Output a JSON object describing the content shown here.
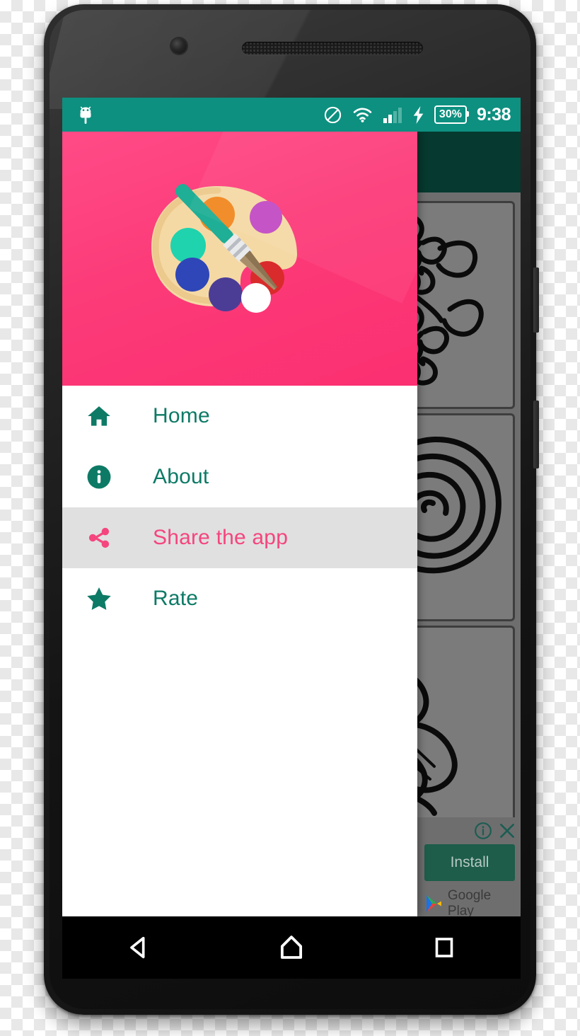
{
  "device": {
    "name": "android-smartphone",
    "front_camera": "front-camera",
    "earpiece": "earpiece-speaker",
    "bottom_speaker": "bottom-speaker",
    "buttons": [
      "power-button",
      "volume-button"
    ]
  },
  "status_bar": {
    "background": "#0d9080",
    "notification_icon": "android-robot-icon",
    "icons": [
      "do-not-disturb-icon",
      "wifi-icon",
      "cellular-signal-icon",
      "charging-bolt-icon"
    ],
    "battery_level": "30%",
    "clock": "9:38"
  },
  "drawer": {
    "background": "#ffffff",
    "header": {
      "background": "#fc3b79",
      "artwork": "paint-palette-with-brush",
      "palette_base_color": "#f7d9a0",
      "brush_handle_color": "#1fae96",
      "well_colors": [
        "#f2871f",
        "#c04bc0",
        "#1fd6b0",
        "#2f46b8",
        "#d92b2b",
        "#4b3d96",
        "#ffffff"
      ]
    },
    "accent_color": "#0d7a66",
    "selected_color": "#f5457e",
    "selected_background": "#e0e0e0",
    "items": [
      {
        "id": "home",
        "label": "Home",
        "icon": "home-icon",
        "selected": false
      },
      {
        "id": "about",
        "label": "About",
        "icon": "info-icon",
        "selected": false
      },
      {
        "id": "share",
        "label": "Share the app",
        "icon": "share-icon",
        "selected": true
      },
      {
        "id": "rate",
        "label": "Rate",
        "icon": "star-icon",
        "selected": false
      }
    ]
  },
  "background_app": {
    "app_bar_color": "#06392f",
    "scrim_color": "#6e6e6e",
    "cards": [
      {
        "id": "card-daisies",
        "artwork": "daisy-flowers-line-art"
      },
      {
        "id": "card-rose",
        "artwork": "rose-line-art"
      },
      {
        "id": "card-lily",
        "artwork": "lily-petals-line-art"
      }
    ]
  },
  "ad_banner": {
    "info_icon": "ad-info-icon",
    "close_icon": "ad-close-icon",
    "install_label": "Install",
    "install_background": "#1d5d4a",
    "store_label": "Google Play",
    "store_icon": "google-play-icon"
  },
  "nav_bar": {
    "background": "#000000",
    "buttons": [
      {
        "id": "back",
        "icon": "back-triangle-icon"
      },
      {
        "id": "home",
        "icon": "home-pentagon-icon"
      },
      {
        "id": "recents",
        "icon": "recents-square-icon"
      }
    ]
  }
}
